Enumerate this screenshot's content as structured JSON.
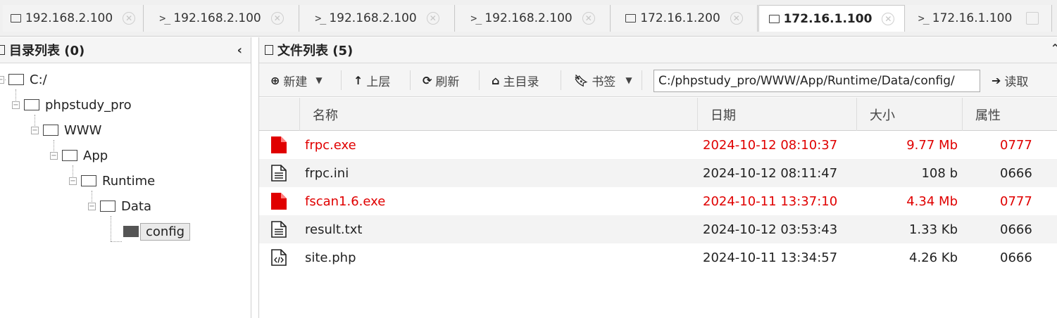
{
  "tabs": [
    {
      "label": "192.168.2.100",
      "kind": "folder",
      "active": false
    },
    {
      "label": "192.168.2.100",
      "kind": "terminal",
      "active": false
    },
    {
      "label": "192.168.2.100",
      "kind": "terminal",
      "active": false
    },
    {
      "label": "192.168.2.100",
      "kind": "terminal",
      "active": false
    },
    {
      "label": "172.16.1.200",
      "kind": "folder",
      "active": false
    },
    {
      "label": "172.16.1.100",
      "kind": "folder",
      "active": true
    },
    {
      "label": "172.16.1.100",
      "kind": "terminal",
      "active": false
    }
  ],
  "left_panel": {
    "title": "目录列表 (0)",
    "collapse_glyph": "‹",
    "tree": [
      {
        "label": "C:/",
        "depth": 0,
        "selected": false,
        "open": true
      },
      {
        "label": "phpstudy_pro",
        "depth": 1,
        "selected": false,
        "open": true
      },
      {
        "label": "WWW",
        "depth": 2,
        "selected": false,
        "open": true
      },
      {
        "label": "App",
        "depth": 3,
        "selected": false,
        "open": true
      },
      {
        "label": "Runtime",
        "depth": 4,
        "selected": false,
        "open": true
      },
      {
        "label": "Data",
        "depth": 5,
        "selected": false,
        "open": true
      },
      {
        "label": "config",
        "depth": 6,
        "selected": true,
        "open": false
      }
    ]
  },
  "right_panel": {
    "title": "文件列表 (5)",
    "toolbar": {
      "new_label": "新建",
      "up_label": "上层",
      "refresh_label": "刷新",
      "home_label": "主目录",
      "bookmark_label": "书签",
      "path_value": "C:/phpstudy_pro/WWW/App/Runtime/Data/config/",
      "read_label": "读取"
    },
    "columns": {
      "name": "名称",
      "date": "日期",
      "size": "大小",
      "attr": "属性"
    },
    "files": [
      {
        "name": "frpc.exe",
        "date": "2024-10-12 08:10:37",
        "size": "9.77 Mb",
        "attr": "0777",
        "icon": "exe-file-icon",
        "danger": true
      },
      {
        "name": "frpc.ini",
        "date": "2024-10-12 08:11:47",
        "size": "108 b",
        "attr": "0666",
        "icon": "text-file-icon",
        "danger": false
      },
      {
        "name": "fscan1.6.exe",
        "date": "2024-10-11 13:37:10",
        "size": "4.34 Mb",
        "attr": "0777",
        "icon": "exe-file-icon",
        "danger": true
      },
      {
        "name": "result.txt",
        "date": "2024-10-12 03:53:43",
        "size": "1.33 Kb",
        "attr": "0666",
        "icon": "text-file-icon",
        "danger": false
      },
      {
        "name": "site.php",
        "date": "2024-10-11 13:34:57",
        "size": "4.26 Kb",
        "attr": "0666",
        "icon": "code-file-icon",
        "danger": false
      }
    ]
  },
  "colors": {
    "danger": "#e00000",
    "alt_row": "#f3f3f3",
    "header_bg": "#f5f5f5"
  }
}
